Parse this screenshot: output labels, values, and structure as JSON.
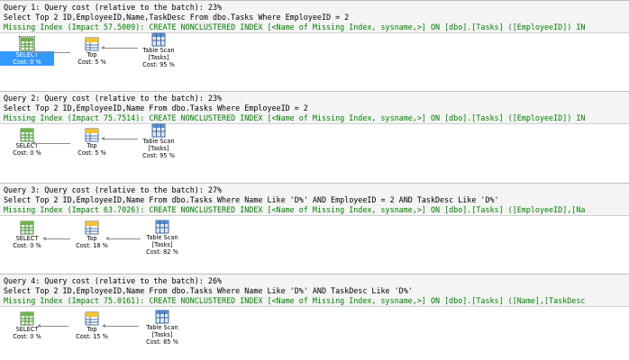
{
  "queries": [
    {
      "header": "Query 1: Query cost (relative to the batch): 23%",
      "sql": "Select Top 2 ID,EmployeeID,Name,TaskDesc From dbo.Tasks Where EmployeeID = 2",
      "missing_index": "Missing Index (Impact 57.5009): CREATE NONCLUSTERED INDEX [<Name of Missing Index, sysname,>] ON [dbo].[Tasks] ([EmployeeID]) IN",
      "select": {
        "name": "SELECT",
        "cost": "Cost: 0 %",
        "selected": true
      },
      "top": {
        "name": "Top",
        "cost": "Cost: 5 %"
      },
      "scan": {
        "name": "Table Scan",
        "object": "[Tasks]",
        "cost": "Cost: 95 %"
      }
    },
    {
      "header": "Query 2: Query cost (relative to the batch): 23%",
      "sql": "Select Top 2 ID,EmployeeID,Name From dbo.Tasks Where EmployeeID = 2",
      "missing_index": "Missing Index (Impact 75.7514): CREATE NONCLUSTERED INDEX [<Name of Missing Index, sysname,>] ON [dbo].[Tasks] ([EmployeeID]) IN",
      "select": {
        "name": "SELECT",
        "cost": "Cost: 0 %",
        "selected": false
      },
      "top": {
        "name": "Top",
        "cost": "Cost: 5 %"
      },
      "scan": {
        "name": "Table Scan",
        "object": "[Tasks]",
        "cost": "Cost: 95 %"
      }
    },
    {
      "header": "Query 3: Query cost (relative to the batch): 27%",
      "sql": "Select Top 2 ID,EmployeeID,Name From dbo.Tasks Where Name Like 'D%' AND EmployeeID = 2 AND TaskDesc Like 'D%'",
      "missing_index": "Missing Index (Impact 63.7026): CREATE NONCLUSTERED INDEX [<Name of Missing Index, sysname,>] ON [dbo].[Tasks] ([EmployeeID],[Na",
      "select": {
        "name": "SELECT",
        "cost": "Cost: 0 %",
        "selected": false
      },
      "top": {
        "name": "Top",
        "cost": "Cost: 18 %"
      },
      "scan": {
        "name": "Table Scan",
        "object": "[Tasks]",
        "cost": "Cost: 82 %"
      }
    },
    {
      "header": "Query 4: Query cost (relative to the batch): 26%",
      "sql": "Select Top 2 ID,EmployeeID,Name From dbo.Tasks Where Name Like 'D%' AND TaskDesc Like 'D%'",
      "missing_index": "Missing Index (Impact 75.0161): CREATE NONCLUSTERED INDEX [<Name of Missing Index, sysname,>] ON [dbo].[Tasks] ([Name],[TaskDesc",
      "select": {
        "name": "SELECT",
        "cost": "Cost: 0 %",
        "selected": false
      },
      "top": {
        "name": "Top",
        "cost": "Cost: 15 %"
      },
      "scan": {
        "name": "Table Scan",
        "object": "[Tasks]",
        "cost": "Cost: 85 %"
      }
    }
  ],
  "icons": {
    "select": "select-result-icon",
    "top": "top-operator-icon",
    "scan": "table-scan-icon"
  },
  "colors": {
    "missing_index_text": "#008000",
    "selection": "#3399ff",
    "header_bg": "#f4f4f4"
  }
}
